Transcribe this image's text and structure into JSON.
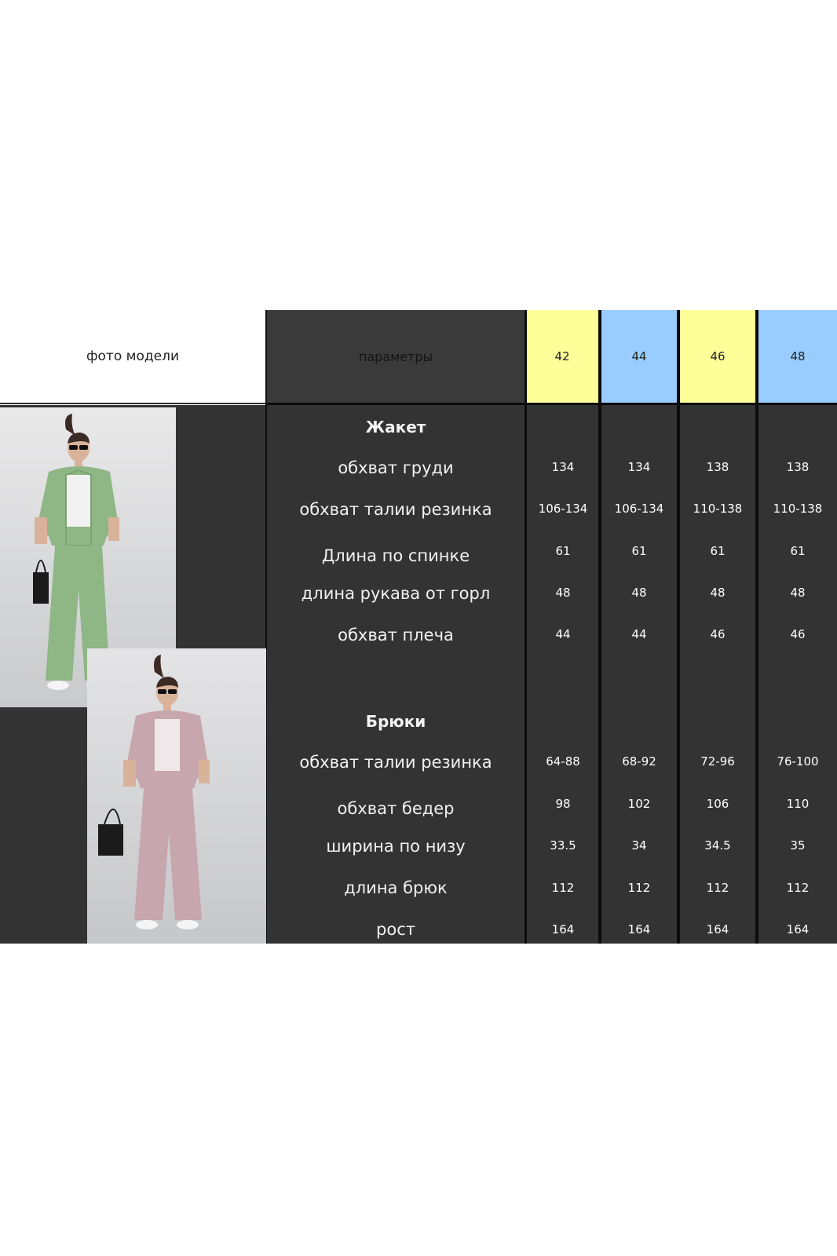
{
  "header": {
    "photo_label": "фото модели",
    "params_label": "параметры",
    "sizes": [
      {
        "label": "42",
        "color": "#ffff99"
      },
      {
        "label": "44",
        "color": "#99ccff"
      },
      {
        "label": "46",
        "color": "#ffff99"
      },
      {
        "label": "48",
        "color": "#99ccff"
      }
    ]
  },
  "photos": [
    {
      "name": "model-green-suit",
      "outfit_color": "#8fb685"
    },
    {
      "name": "model-pink-suit",
      "outfit_color": "#c7a6ad"
    }
  ],
  "jacket": {
    "title": "Жакет",
    "rows": [
      {
        "label": "обхват груди",
        "values": [
          "134",
          "134",
          "138",
          "138"
        ]
      },
      {
        "label": "обхват талии резинка",
        "values": [
          "106-134",
          "106-134",
          "110-138",
          "110-138"
        ]
      },
      {
        "label": "Длина по спинке",
        "values": [
          "61",
          "61",
          "61",
          "61"
        ]
      },
      {
        "label": "длина рукава от горл",
        "values": [
          "48",
          "48",
          "48",
          "48"
        ]
      },
      {
        "label": "обхват плеча",
        "values": [
          "44",
          "44",
          "46",
          "46"
        ]
      }
    ]
  },
  "trousers": {
    "title": "Брюки",
    "rows": [
      {
        "label": "обхват талии резинка",
        "values": [
          "64-88",
          "68-92",
          "72-96",
          "76-100"
        ]
      },
      {
        "label": "обхват бедер",
        "values": [
          "98",
          "102",
          "106",
          "110"
        ]
      },
      {
        "label": "ширина по низу",
        "values": [
          "33.5",
          "34",
          "34.5",
          "35"
        ]
      },
      {
        "label": "длина брюк",
        "values": [
          "112",
          "112",
          "112",
          "112"
        ]
      },
      {
        "label": "рост",
        "values": [
          "164",
          "164",
          "164",
          "164"
        ]
      }
    ]
  }
}
